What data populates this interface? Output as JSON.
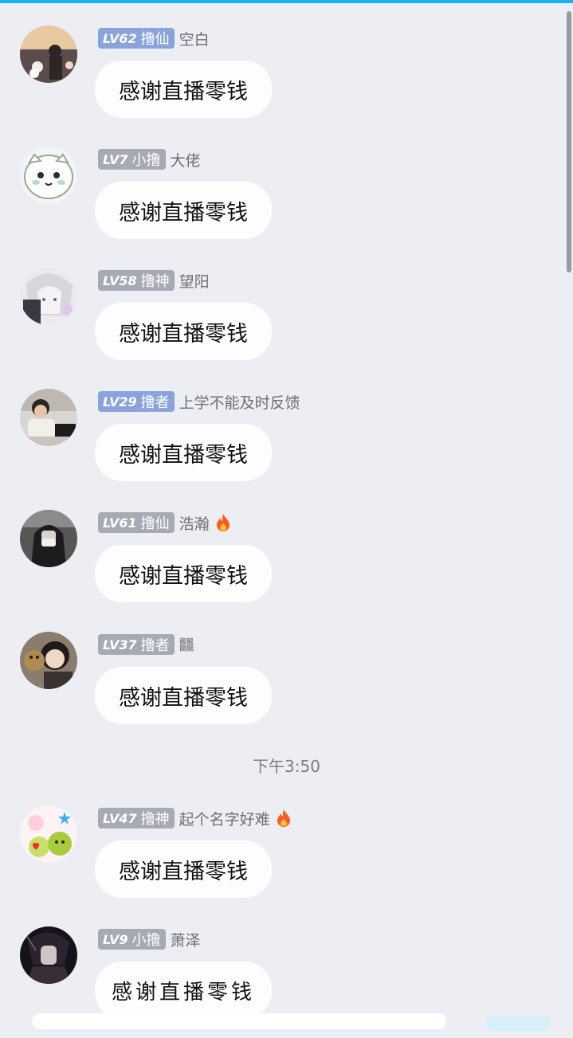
{
  "colors": {
    "accent_bar": "#19b4ee",
    "badge_blue": "#8aa3dc",
    "badge_gray": "#a7aab3",
    "fire": "#ff5a1f"
  },
  "messages": [
    {
      "level": "LV62",
      "title": "撸仙",
      "name": "空白",
      "text": "感谢直播零钱",
      "badge_color": "blue",
      "fire": false,
      "avatar_icon": "avatar-photo-couple"
    },
    {
      "level": "LV7",
      "title": "小撸",
      "name": "大佬",
      "text": "感谢直播零钱",
      "badge_color": "gray",
      "fire": false,
      "avatar_icon": "avatar-cartoon-face"
    },
    {
      "level": "LV58",
      "title": "撸神",
      "name": "望阳",
      "text": "感谢直播零钱",
      "badge_color": "gray",
      "fire": false,
      "avatar_icon": "avatar-anime"
    },
    {
      "level": "LV29",
      "title": "撸者",
      "name": "上学不能及时反馈",
      "text": "感谢直播零钱",
      "badge_color": "blue",
      "fire": false,
      "avatar_icon": "avatar-photo-child"
    },
    {
      "level": "LV61",
      "title": "撸仙",
      "name": "浩瀚",
      "text": "感谢直播零钱",
      "badge_color": "gray",
      "fire": true,
      "avatar_icon": "avatar-photo-masked"
    },
    {
      "level": "LV37",
      "title": "撸者",
      "name": "𪚥",
      "text": "感谢直播零钱",
      "badge_color": "gray",
      "fire": false,
      "avatar_icon": "avatar-photo-girl"
    },
    {
      "level": "LV47",
      "title": "撸神",
      "name": "起个名字好难",
      "text": "感谢直播零钱",
      "badge_color": "gray",
      "fire": true,
      "avatar_icon": "avatar-cartoon-fruit"
    },
    {
      "level": "LV9",
      "title": "小撸",
      "name": "萧泽",
      "text": "感谢直播零钱",
      "badge_color": "gray",
      "fire": false,
      "avatar_icon": "avatar-anime-dark"
    }
  ],
  "timestamp": "下午3:50"
}
